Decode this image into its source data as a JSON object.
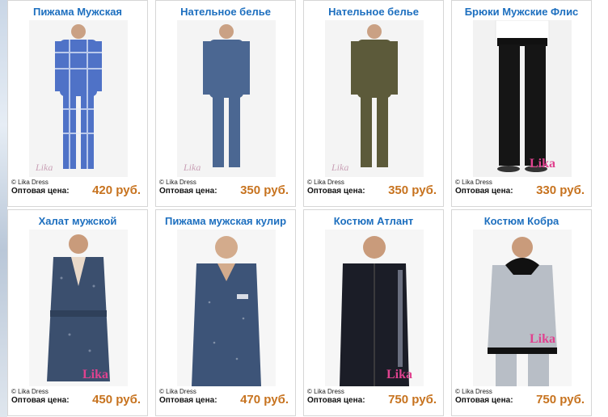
{
  "products": [
    {
      "title": "Пижама Мужская",
      "copyright": "© Lika Dress",
      "price_label": "Оптовая цена:",
      "price": "420 руб.",
      "photo_color": "#4f72c7",
      "photo_bg": "#f4f4f4",
      "icon": "pajama-plaid-photo"
    },
    {
      "title": "Нательное белье",
      "copyright": "© Lika Dress",
      "price_label": "Оптовая цена:",
      "price": "350 руб.",
      "photo_color": "#4b6792",
      "photo_bg": "#f4f4f4",
      "icon": "thermal-underwear-photo"
    },
    {
      "title": "Нательное белье",
      "copyright": "© Lika Dress",
      "price_label": "Оптовая цена:",
      "price": "350 руб.",
      "photo_color": "#5c5a3a",
      "photo_bg": "#f4f4f4",
      "icon": "thermal-underwear-photo"
    },
    {
      "title": "Брюки Мужские Флис",
      "copyright": "© Lika Dress",
      "price_label": "Оптовая цена:",
      "price": "330 руб.",
      "photo_color": "#151515",
      "photo_bg": "#f2f2f2",
      "icon": "fleece-pants-photo"
    },
    {
      "title": "Халат мужской",
      "copyright": "© Lika Dress",
      "price_label": "Оптовая цена:",
      "price": "450 руб.",
      "photo_color": "#3b4f6e",
      "photo_bg": "#f6f6f6",
      "icon": "robe-photo"
    },
    {
      "title": "Пижама мужская кулир",
      "copyright": "© Lika Dress",
      "price_label": "Оптовая цена:",
      "price": "470 руб.",
      "photo_color": "#3d5478",
      "photo_bg": "#f6f6f6",
      "icon": "pajama-photo"
    },
    {
      "title": "Костюм Атлант",
      "copyright": "© Lika Dress",
      "price_label": "Оптовая цена:",
      "price": "750 руб.",
      "photo_color": "#1b1d27",
      "photo_bg": "#f6f6f6",
      "icon": "tracksuit-photo"
    },
    {
      "title": "Костюм Кобра",
      "copyright": "© Lika Dress",
      "price_label": "Оптовая цена:",
      "price": "750 руб.",
      "photo_color": "#b8bec6",
      "photo_bg": "#f6f6f6",
      "icon": "hoodie-suit-photo"
    }
  ],
  "brand_logo_text": "Lika dress"
}
